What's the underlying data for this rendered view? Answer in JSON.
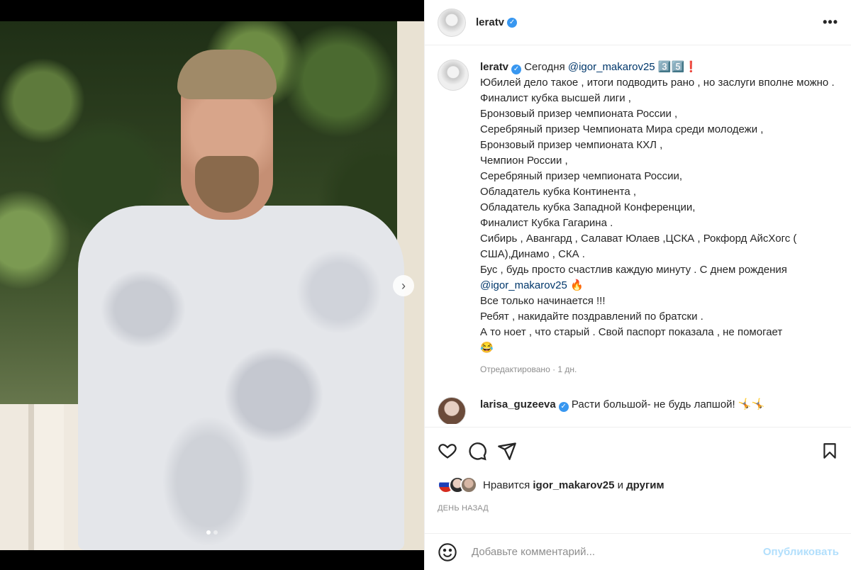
{
  "header": {
    "username": "leratv",
    "verified_mark": "✓",
    "more_label": "•••"
  },
  "caption": {
    "username": "leratv",
    "intro": " Сегодня ",
    "mention1": "@igor_makarov25",
    "intro_tail": " 3️⃣5️⃣❗",
    "lines": [
      "Юбилей дело такое , итоги подводить рано , но заслуги вполне можно .",
      "Финалист кубка высшей лиги ,",
      "Бронзовый призер чемпионата России ,",
      "Серебряный призер Чемпионата Мира среди молодежи ,",
      "Бронзовый призер чемпионата КХЛ ,",
      "Чемпион России ,",
      "Серебряный призер чемпионата России,",
      "Обладатель кубка Континента ,",
      "Обладатель кубка Западной Конференции,",
      "Финалист Кубка Гагарина .",
      "Сибирь , Авангард , Салават Юлаев ,ЦСКА , Рокфорд АйсХогс ( США),Динамо , СКА .",
      "Бус , будь просто счастлив каждую минуту . С днем рождения"
    ],
    "mention2": "@igor_makarov25",
    "mention2_tail": " 🔥",
    "lines_after": [
      "Все только начинается !!!",
      "Ребят , накидайте поздравлений по братски .",
      "А то ноет , что старый . Свой паспорт показала , не помогает",
      "😂"
    ],
    "meta": "Отредактировано · 1 дн."
  },
  "comment": {
    "username": "larisa_guzeeva",
    "text": " Расти большой- не будь лапшой! 🤸🤸"
  },
  "likes": {
    "prefix": "Нравится ",
    "user": "igor_makarov25",
    "middle": " и ",
    "others": "другим"
  },
  "posted": "ДЕНЬ НАЗАД",
  "add_comment": {
    "placeholder": "Добавьте комментарий...",
    "post_label": "Опубликовать"
  },
  "carousel": {
    "next_label": "›",
    "slides": 2,
    "current": 1
  },
  "colors": {
    "verified": "#3897f0",
    "mention": "#00376b",
    "post_disabled": "#b2dffc",
    "muted": "#8e8e8e"
  },
  "icons": [
    "heart-icon",
    "comment-icon",
    "share-icon",
    "bookmark-icon",
    "emoji-icon",
    "chevron-right-icon",
    "more-icon"
  ]
}
